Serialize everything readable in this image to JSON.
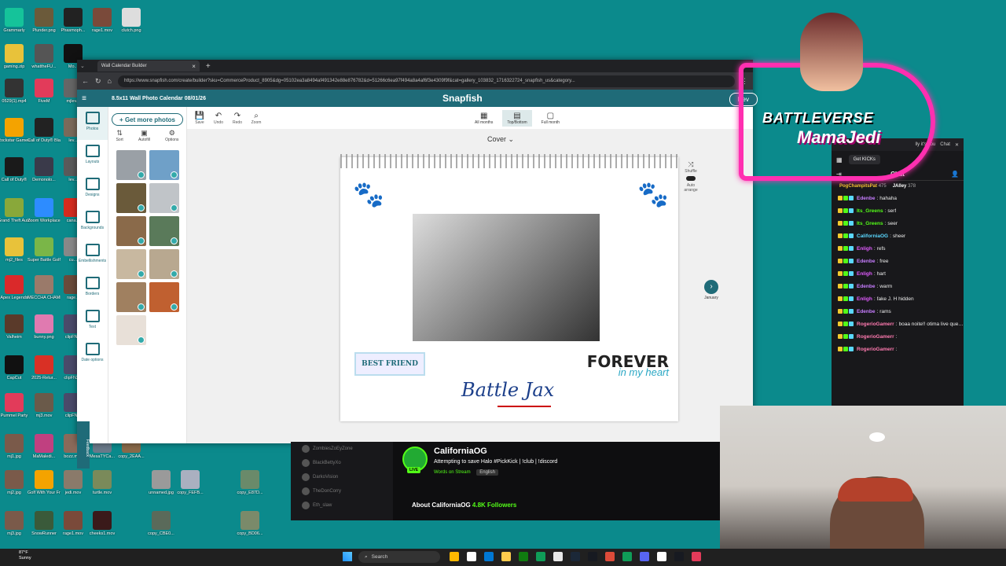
{
  "desktop": {
    "icons": [
      {
        "label": "Grammarly",
        "color": "#15c39a"
      },
      {
        "label": "Plunder.png",
        "color": "#6b5a3a"
      },
      {
        "label": "Phasmoph...",
        "color": "#222222"
      },
      {
        "label": "rage1.mov",
        "color": "#7a4a3a"
      },
      {
        "label": "clutch.png",
        "color": "#dddddd"
      },
      {
        "label": "gaming.zip",
        "color": "#e8c23a"
      },
      {
        "label": "whattheFU...",
        "color": "#555555"
      },
      {
        "label": "Mo...",
        "color": "#111111"
      },
      {
        "label": "0529(1).mp4",
        "color": "#333333"
      },
      {
        "label": "FiveM",
        "color": "#e23b5a"
      },
      {
        "label": "mjlev...",
        "color": "#666666"
      },
      {
        "label": "Rockstar Games ...",
        "color": "#f4a300"
      },
      {
        "label": "Call of Duty® Bla...",
        "color": "#222222"
      },
      {
        "label": "lev...",
        "color": "#7a6a5a"
      },
      {
        "label": "Call of Duty®",
        "color": "#1a1a1a"
      },
      {
        "label": "Demonolo...",
        "color": "#3a3a4a"
      },
      {
        "label": "lev...",
        "color": "#5a5a5a"
      },
      {
        "label": "Grand Theft Auto V Le...",
        "color": "#89a83a"
      },
      {
        "label": "Zoom Workplace",
        "color": "#2d8cff"
      },
      {
        "label": "cana...",
        "color": "#d52b1e"
      },
      {
        "label": "mj2_files",
        "color": "#e8c23a"
      },
      {
        "label": "Super Battle Golf",
        "color": "#7ab648"
      },
      {
        "label": "cu...",
        "color": "#888888"
      },
      {
        "label": "Apex Legends",
        "color": "#da292a"
      },
      {
        "label": "MECCHA CHAMELE...",
        "color": "#9a7a6a"
      },
      {
        "label": "rage...",
        "color": "#6a4a3a"
      },
      {
        "label": "Valheim",
        "color": "#5a3a2a"
      },
      {
        "label": "bunny.png",
        "color": "#e07ab0"
      },
      {
        "label": "clipFN...",
        "color": "#4a4a6a"
      },
      {
        "label": "CapCut",
        "color": "#111111"
      },
      {
        "label": "2025-Retur...",
        "color": "#d93025"
      },
      {
        "label": "clipFN2...",
        "color": "#4a4a6a"
      },
      {
        "label": "Pummel Party",
        "color": "#e23b5a"
      },
      {
        "label": "mj3.mov",
        "color": "#6a5a4a"
      },
      {
        "label": "clipFN...",
        "color": "#4a4a6a"
      },
      {
        "label": "mj1.jpg",
        "color": "#7a5a4a"
      },
      {
        "label": "MaMaledi...",
        "color": "#c04080"
      },
      {
        "label": "bozz.mov",
        "color": "#8a6a5a"
      },
      {
        "label": "MesaTYCa...",
        "color": "#6a7a8a"
      },
      {
        "label": "copy_2EAA...",
        "color": "#8a6a4a"
      },
      {
        "label": "mj2.jpg",
        "color": "#7a5a4a"
      },
      {
        "label": "Golf With Your Friends",
        "color": "#f4a300"
      },
      {
        "label": "jedi.mov",
        "color": "#8a7a6a"
      },
      {
        "label": "turtle.mov",
        "color": "#7a8a5a"
      },
      {
        "label": "unnamed.jpg",
        "color": "#9a9a9a"
      },
      {
        "label": "copy_FEFB...",
        "color": "#aab0c0"
      },
      {
        "label": "copy_E87D...",
        "color": "#6a8a6a"
      },
      {
        "label": "mj3.jpg",
        "color": "#7a5a4a"
      },
      {
        "label": "SnowRunner",
        "color": "#3a5a3a"
      },
      {
        "label": "rage1.mov",
        "color": "#7a4a3a"
      },
      {
        "label": "cheeks1.mov",
        "color": "#3a1a1a"
      },
      {
        "label": "copy_CBE0...",
        "color": "#5a6a5a"
      },
      {
        "label": "copy_BD06...",
        "color": "#7a8a6a"
      }
    ]
  },
  "browser": {
    "tab_title": "Wall Calendar Builder",
    "tab_close": "×",
    "new_tab": "+",
    "url": "https://www.snapfish.com/create/builder?sku=CommerceProduct_8905&dg=05102ea3a8494af491342e88e876782&d=51266c6ea97f494a8a4af6f3e4309f9f&cat=gallery_103832_1716322724_snapfish_us&category..."
  },
  "app": {
    "doc_title": "8.5x11 Wall Photo Calendar 08/01/26",
    "brand": "Snapfish",
    "review_btn": "Rev",
    "sidebar": [
      {
        "label": "Photos"
      },
      {
        "label": "Layouts"
      },
      {
        "label": "Designs"
      },
      {
        "label": "Backgrounds"
      },
      {
        "label": "Embellishments"
      },
      {
        "label": "Borders"
      },
      {
        "label": "Text"
      },
      {
        "label": "Date options"
      }
    ],
    "feedback": "Feedback",
    "get_more_photos": "+ Get more photos",
    "sort_tools": [
      {
        "icon": "⇅",
        "label": "Sort"
      },
      {
        "icon": "▣",
        "label": "Autofill"
      },
      {
        "icon": "⚙",
        "label": "Options"
      }
    ],
    "thumb_colors": [
      "#9aa0a6",
      "#6fa0c8",
      "#6a5a3a",
      "#c0c4c8",
      "#8a6a4a",
      "#5a7a5a",
      "#c8b8a0",
      "#b8a890",
      "#a08060",
      "#c06030",
      "#e8e0d8"
    ],
    "toolbar": [
      {
        "icon": "💾",
        "label": "Save"
      },
      {
        "icon": "↶",
        "label": "Undo"
      },
      {
        "icon": "↷",
        "label": "Redo"
      },
      {
        "icon": "⌕",
        "label": "Zoom"
      }
    ],
    "view_tabs": [
      {
        "icon": "▦",
        "label": "All months"
      },
      {
        "icon": "▤",
        "label": "Top/Bottom"
      },
      {
        "icon": "▢",
        "label": "Full month"
      }
    ],
    "cover_label": "Cover ⌄",
    "page_tools": {
      "shuffle": "Shuffle",
      "auto": "Auto arrange"
    },
    "next_label": "January",
    "best_friend": "BEST FRIEND",
    "forever1": "FOREVER",
    "forever2": "in my heart",
    "battle": "Battle Jax"
  },
  "kick": {
    "sidebar_users": [
      "ZombiesZoEyZone",
      "BlackBettyXo",
      "DarkoVision",
      "TheDonCorry",
      "Eth_slaw"
    ],
    "streamer": "CaliforniaOG",
    "live": "LIVE",
    "title": "Attempting to save Halo #PickKick | !club | !discord",
    "category": "Words on Stream",
    "language": "English",
    "about": "About CaliforniaOG",
    "followers": "4.8K Followers"
  },
  "chat": {
    "search_text": "lly it's you",
    "top_chat": "Chat",
    "get_kicks": "Get KICKs",
    "title": "Chat",
    "pinned": [
      {
        "name": "PogChampitsPat",
        "count": "475"
      },
      {
        "name": "JAlley",
        "count": "378"
      }
    ],
    "messages": [
      {
        "user": "Edenbe",
        "text": "hahaha",
        "color": "#c77dff"
      },
      {
        "user": "Its_Greens",
        "text": "serf",
        "color": "#53fc18"
      },
      {
        "user": "Its_Greens",
        "text": "seer",
        "color": "#53fc18"
      },
      {
        "user": "CaliforniaOG",
        "text": "sheer",
        "color": "#5ad8ff"
      },
      {
        "user": "Enligh",
        "text": "refs",
        "color": "#e05bff"
      },
      {
        "user": "Edenbe",
        "text": "free",
        "color": "#c77dff"
      },
      {
        "user": "Enligh",
        "text": "hart",
        "color": "#e05bff"
      },
      {
        "user": "Edenbe",
        "text": "warm",
        "color": "#c77dff"
      },
      {
        "user": "Enligh",
        "text": "fake J. H hidden",
        "color": "#e05bff"
      },
      {
        "user": "Edenbe",
        "text": "rams",
        "color": "#c77dff"
      },
      {
        "user": "RogerioGamerr",
        "text": "boaa noite!! otima live que Deus acompanhe nossa jornada",
        "color": "#ff7ab0"
      },
      {
        "user": "RogerioGamerr",
        "text": "",
        "color": "#ff7ab0"
      },
      {
        "user": "RogerioGamerr",
        "text": "",
        "color": "#ff7ab0"
      }
    ]
  },
  "overlay": {
    "line1": "BATTLEVERSE",
    "line2": "MamaJedi"
  },
  "taskbar": {
    "temp": "87°F",
    "condition": "Sunny",
    "search": "Search",
    "apps": [
      "#ffb900",
      "#ffffff",
      "#0078d4",
      "#ffcc4d",
      "#107c10",
      "#0f9d58",
      "#e8e8e8",
      "#1b2838",
      "#171a21",
      "#dd4b39",
      "#0f9d58",
      "#5865f2",
      "#ffffff",
      "#171a21",
      "#e23b5a"
    ]
  }
}
